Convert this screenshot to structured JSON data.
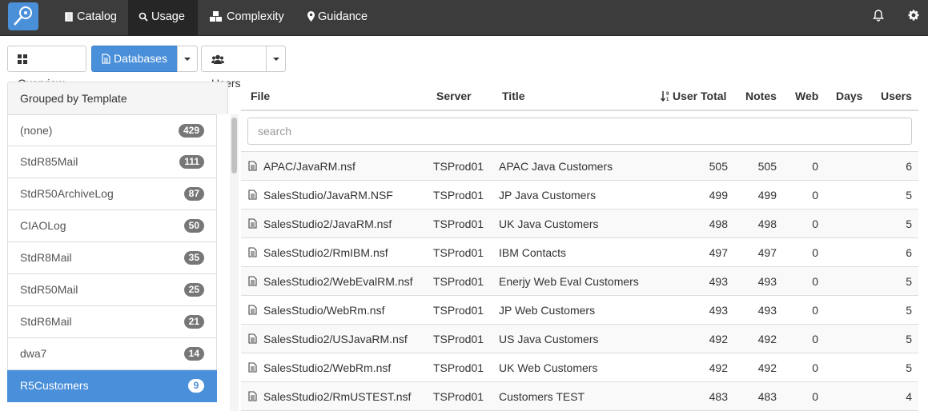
{
  "nav": {
    "items": [
      {
        "label": "Catalog",
        "icon": "book-icon"
      },
      {
        "label": "Usage",
        "icon": "search-icon",
        "active": true
      },
      {
        "label": "Complexity",
        "icon": "cubes-icon"
      },
      {
        "label": "Guidance",
        "icon": "map-marker-icon"
      }
    ]
  },
  "toolbar": {
    "overview": "Overview",
    "databases": "Databases",
    "users": "Users"
  },
  "groups": {
    "title": "Grouped by Template",
    "items": [
      {
        "label": "(none)",
        "count": "429"
      },
      {
        "label": "StdR85Mail",
        "count": "111"
      },
      {
        "label": "StdR50ArchiveLog",
        "count": "87"
      },
      {
        "label": "CIAOLog",
        "count": "50"
      },
      {
        "label": "StdR8Mail",
        "count": "35"
      },
      {
        "label": "StdR50Mail",
        "count": "25"
      },
      {
        "label": "StdR6Mail",
        "count": "21"
      },
      {
        "label": "dwa7",
        "count": "14"
      },
      {
        "label": "R5Customers",
        "count": "9",
        "active": true
      }
    ]
  },
  "table": {
    "columns": {
      "file": "File",
      "server": "Server",
      "title": "Title",
      "user_total": "User Total",
      "notes": "Notes",
      "web": "Web",
      "days": "Days",
      "users": "Users"
    },
    "search_placeholder": "search",
    "rows": [
      {
        "file": "APAC/JavaRM.nsf",
        "server": "TSProd01",
        "title": "APAC Java Customers",
        "user_total": "505",
        "notes": "505",
        "web": "0",
        "days": "",
        "users": "6"
      },
      {
        "file": "SalesStudio/JavaRM.NSF",
        "server": "TSProd01",
        "title": "JP Java Customers",
        "user_total": "499",
        "notes": "499",
        "web": "0",
        "days": "",
        "users": "5"
      },
      {
        "file": "SalesStudio2/JavaRM.nsf",
        "server": "TSProd01",
        "title": "UK Java Customers",
        "user_total": "498",
        "notes": "498",
        "web": "0",
        "days": "",
        "users": "5"
      },
      {
        "file": "SalesStudio2/RmIBM.nsf",
        "server": "TSProd01",
        "title": "IBM Contacts",
        "user_total": "497",
        "notes": "497",
        "web": "0",
        "days": "",
        "users": "6"
      },
      {
        "file": "SalesStudio2/WebEvalRM.nsf",
        "server": "TSProd01",
        "title": "Enerjy Web Eval Customers",
        "user_total": "493",
        "notes": "493",
        "web": "0",
        "days": "",
        "users": "5"
      },
      {
        "file": "SalesStudio/WebRm.nsf",
        "server": "TSProd01",
        "title": "JP Web Customers",
        "user_total": "493",
        "notes": "493",
        "web": "0",
        "days": "",
        "users": "5"
      },
      {
        "file": "SalesStudio2/USJavaRM.nsf",
        "server": "TSProd01",
        "title": "US Java Customers",
        "user_total": "492",
        "notes": "492",
        "web": "0",
        "days": "",
        "users": "5"
      },
      {
        "file": "SalesStudio2/WebRm.nsf",
        "server": "TSProd01",
        "title": "UK Web Customers",
        "user_total": "492",
        "notes": "492",
        "web": "0",
        "days": "",
        "users": "5"
      },
      {
        "file": "SalesStudio2/RmUSTEST.nsf",
        "server": "TSProd01",
        "title": "Customers TEST",
        "user_total": "483",
        "notes": "483",
        "web": "0",
        "days": "",
        "users": "4"
      }
    ]
  },
  "colors": {
    "navbar": "#3c3c3c",
    "accent": "#4a8fd9",
    "badge": "#777777"
  }
}
